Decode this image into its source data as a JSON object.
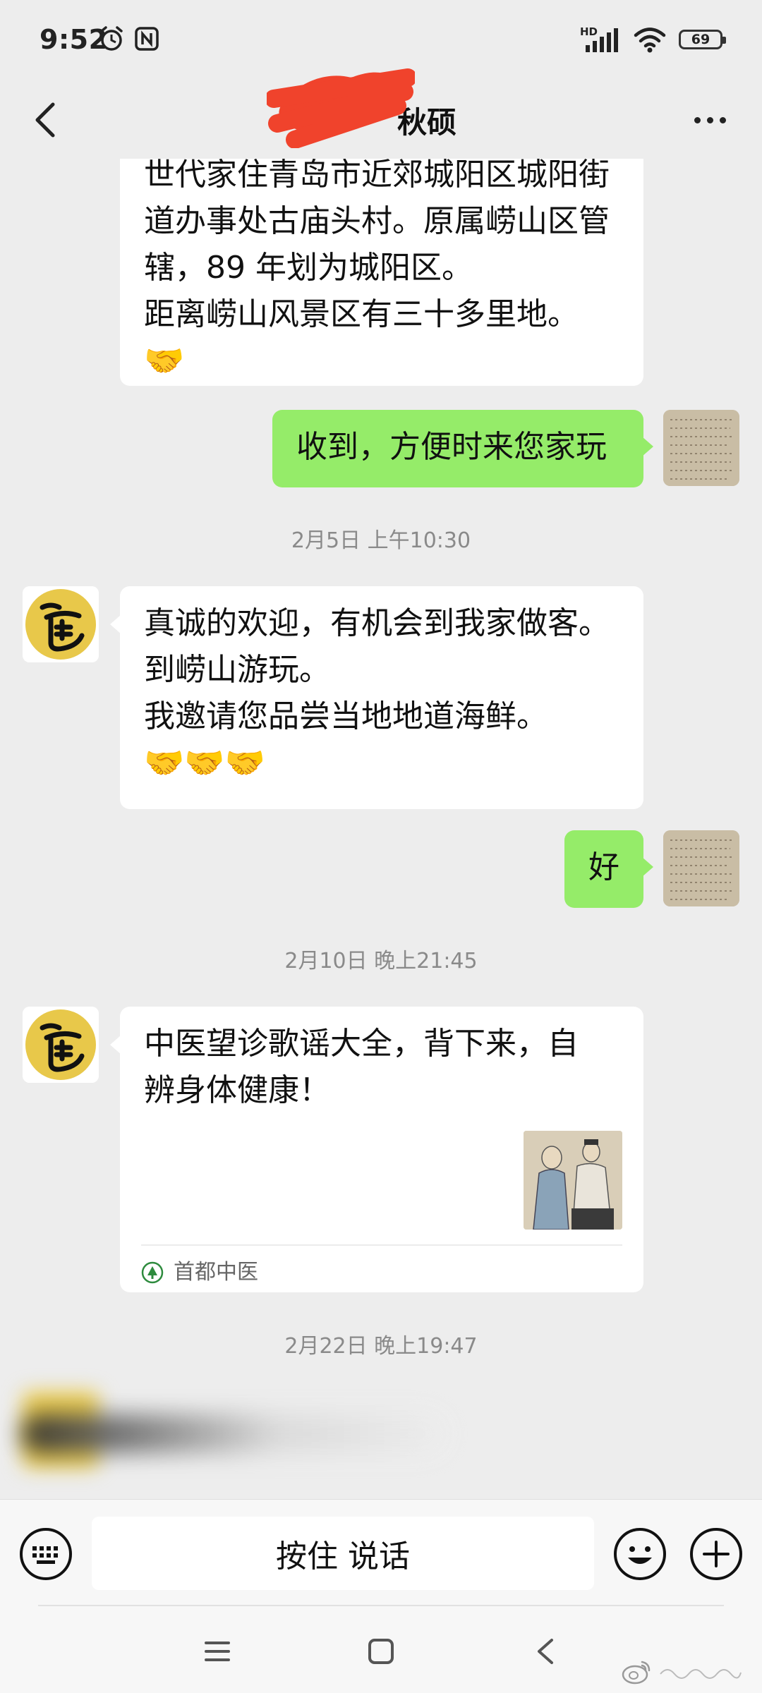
{
  "status_bar": {
    "time": "9:52",
    "network": "HD",
    "battery": "69"
  },
  "header": {
    "title": "秋硕"
  },
  "messages": {
    "m1": {
      "lines": [
        "世代家住青岛市近郊城阳区城阳街",
        "道办事处古庙头村。原属崂山区管",
        "辖，89 年划为城阳区。",
        "距离崂山风景区有三十多里地。"
      ],
      "emoji": "🤝"
    },
    "m2": {
      "text": "收到，方便时来您家玩"
    },
    "ts1": "2月5日 上午10:30",
    "m3": {
      "lines": [
        "真诚的欢迎，有机会到我家做客。",
        "到崂山游玩。",
        "我邀请您品尝当地地道海鲜。"
      ],
      "emoji": "🤝🤝🤝"
    },
    "m4": {
      "text": "好"
    },
    "ts2": "2月10日 晚上21:45",
    "m5": {
      "lines": [
        "中医望诊歌谣大全，背下来，自",
        "辨身体健康！"
      ],
      "source": "首都中医"
    },
    "ts3": "2月22日 晚上19:47"
  },
  "input_bar": {
    "voice_label": "按住 说话"
  },
  "colors": {
    "background": "#ededed",
    "bubble_sent": "#95ec69",
    "bubble_received": "#ffffff",
    "timestamp": "#8a8a8a"
  }
}
